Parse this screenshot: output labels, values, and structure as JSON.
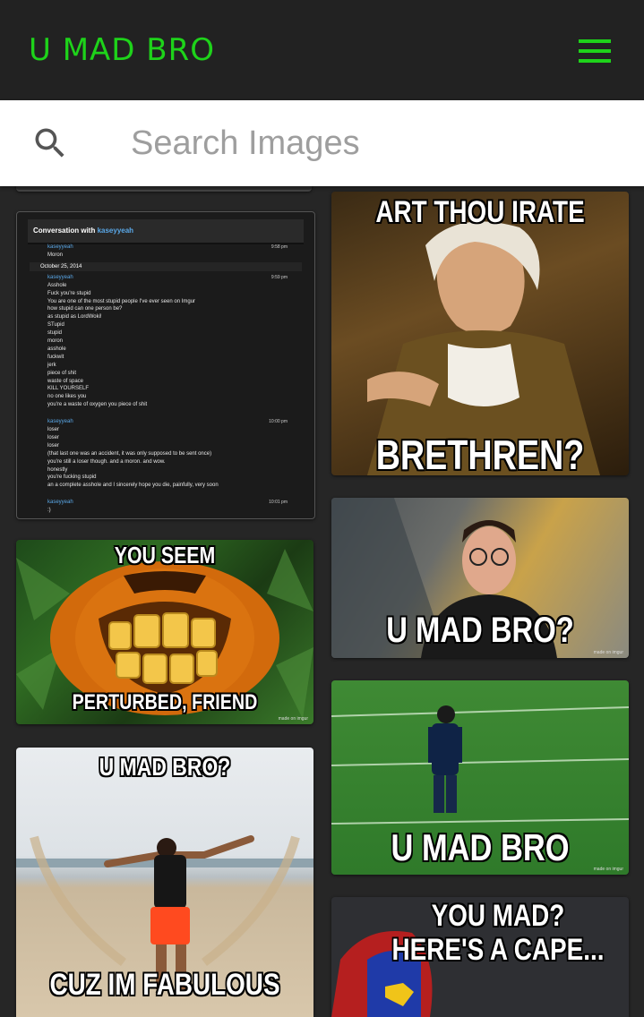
{
  "header": {
    "logo": "U MAD BRO",
    "menu_icon": "hamburger-menu-icon"
  },
  "search": {
    "placeholder": "Search Images",
    "value": "",
    "icon": "search-icon"
  },
  "colors": {
    "brand": "#1ed31a",
    "topbar": "#222222",
    "background": "#262626"
  },
  "chat_card": {
    "title_prefix": "Conversation with",
    "username": "kaseyyeah",
    "date_divider": "October 25, 2014",
    "messages": [
      {
        "user": "kaseyyeah",
        "time": "9:58 pm",
        "lines": [
          "Moron"
        ]
      },
      {
        "user": "kaseyyeah",
        "time": "9:59 pm",
        "lines": [
          "Asshole",
          "Fuck you're stupid",
          "You are one of the most stupid people I've ever seen on Imgur",
          "how stupid can one person be?",
          "as stupid as LordWoki!",
          "STupid",
          "stupid",
          "moron",
          "asshole",
          "fuckwit",
          "jerk",
          "piece of shit",
          "waste of space",
          "KILL YOURSELF",
          "no one likes you",
          "you're a waste of oxygen you piece of shit"
        ]
      },
      {
        "user": "kaseyyeah",
        "time": "10:00 pm",
        "lines": [
          "loser",
          "loser",
          "loser",
          "(that last one was an accident, it was only supposed to be sent once)",
          "you're still a loser though. and a moron. and wow.",
          "honestly",
          "you're fucking stupid",
          "an a complete asshole and I sincerely hope you die, painfully, very soon"
        ]
      },
      {
        "user": "kaseyyeah",
        "time": "10:01 pm",
        "lines": [
          ":)"
        ]
      }
    ]
  },
  "memes": {
    "pumpkin": {
      "top": "YOU SEEM",
      "bottom": "PERTURBED, FRIEND",
      "watermark": "made on imgur"
    },
    "beach": {
      "top": "U MAD BRO?",
      "bottom": "CUZ IM FABULOUS"
    },
    "irate": {
      "top": "ART THOU IRATE",
      "bottom": "BRETHREN?"
    },
    "glasses": {
      "bottom": "U MAD BRO?",
      "watermark": "made on imgur"
    },
    "football": {
      "bottom": "U MAD BRO",
      "watermark": "made on imgur"
    },
    "cape": {
      "top_line1": "YOU MAD?",
      "top_line2": "HERE'S A CAPE..."
    }
  }
}
